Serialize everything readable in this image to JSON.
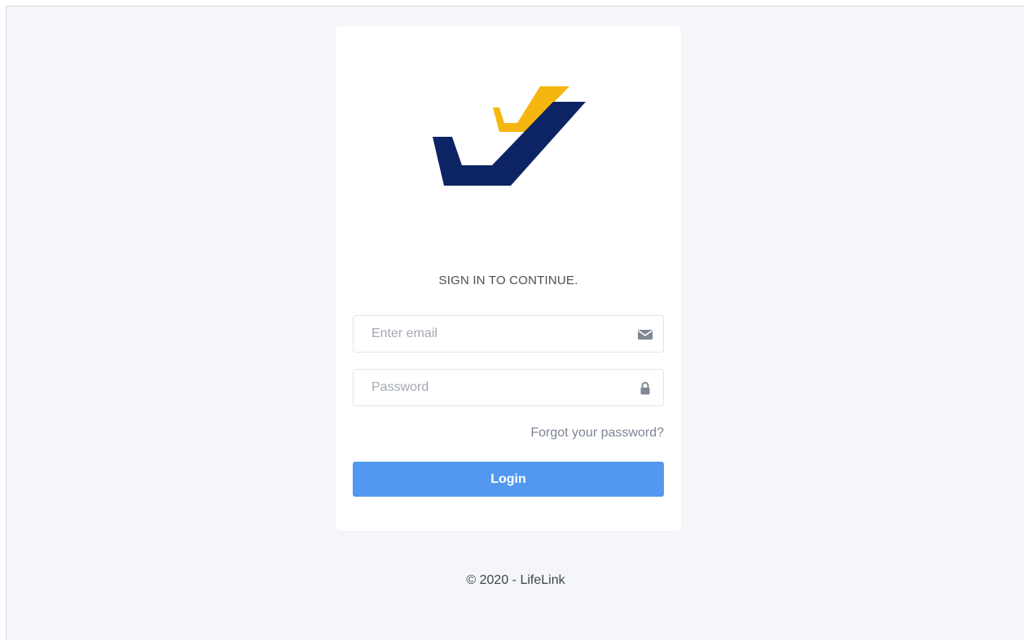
{
  "header": {
    "title": "SIGN IN TO CONTINUE."
  },
  "form": {
    "email": {
      "value": "",
      "placeholder": "Enter email",
      "icon": "envelope-icon"
    },
    "password": {
      "value": "",
      "placeholder": "Password",
      "icon": "lock-icon"
    },
    "forgot_label": "Forgot your password?",
    "login_label": "Login"
  },
  "footer": {
    "text": "© 2020 - LifeLink"
  },
  "colors": {
    "background": "#f5f6fa",
    "card": "#ffffff",
    "logo_navy": "#0c2463",
    "logo_gold": "#f5b70f",
    "button": "#5398f0",
    "link": "#7c8593",
    "input_border": "#e1e4ea"
  }
}
